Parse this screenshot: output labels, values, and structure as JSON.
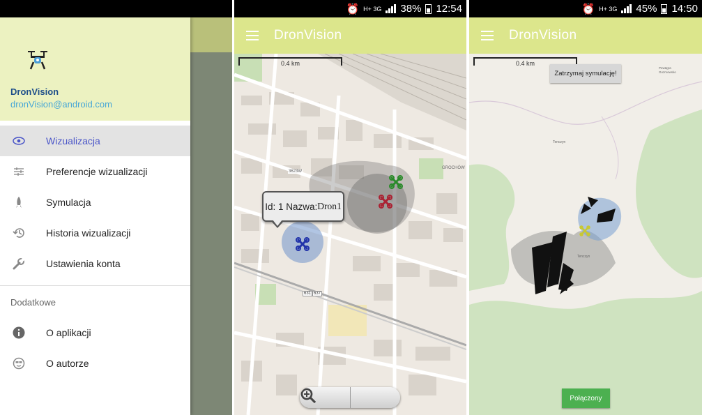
{
  "screens": {
    "drawer": {
      "app_name": "DronVision",
      "email": "dronVision@android.com",
      "menu": [
        {
          "label": "Wizualizacja",
          "icon": "eye-icon",
          "active": true
        },
        {
          "label": "Preferencje wizualizacji",
          "icon": "sliders-icon",
          "active": false
        },
        {
          "label": "Symulacja",
          "icon": "rocket-icon",
          "active": false
        },
        {
          "label": "Historia wizualizacji",
          "icon": "history-icon",
          "active": false
        },
        {
          "label": "Ustawienia konta",
          "icon": "wrench-icon",
          "active": false
        }
      ],
      "section_label": "Dodatkowe",
      "extra_menu": [
        {
          "label": "O aplikacji",
          "icon": "info-icon"
        },
        {
          "label": "O autorze",
          "icon": "face-icon"
        }
      ]
    },
    "map_view": {
      "status": {
        "battery": "38%",
        "time": "12:54",
        "network": "H+ 3G"
      },
      "title": "DronVision",
      "scale_label": "0.4 km",
      "tooltip": {
        "id_label": "Id: 1 Nazwa:",
        "name": "Dron1"
      },
      "map_labels": {
        "street_code": "3623W",
        "road_1": "631",
        "road_2": "637",
        "area": "GROCHÓW"
      }
    },
    "simulation": {
      "status": {
        "battery": "45%",
        "time": "14:50",
        "network": "H+ 3G"
      },
      "title": "DronVision",
      "scale_label": "0.4 km",
      "stop_button": "Zatrzymaj symulację!",
      "connected_button": "Połączony",
      "map_labels": {
        "place_1": "Tenczyn",
        "place_2": "Tenczyn",
        "place_3": "Pewägra Gozmowsko"
      }
    }
  },
  "colors": {
    "appbar": "#dce68c",
    "drawer_header": "#ecf2c1",
    "active_item_text": "#4b56c8",
    "connected_button": "#4cb050",
    "drone_blue": "#2233aa",
    "drone_red": "#aa2233",
    "drone_green": "#2a8a2a",
    "drone_yellow": "#c8c832"
  }
}
